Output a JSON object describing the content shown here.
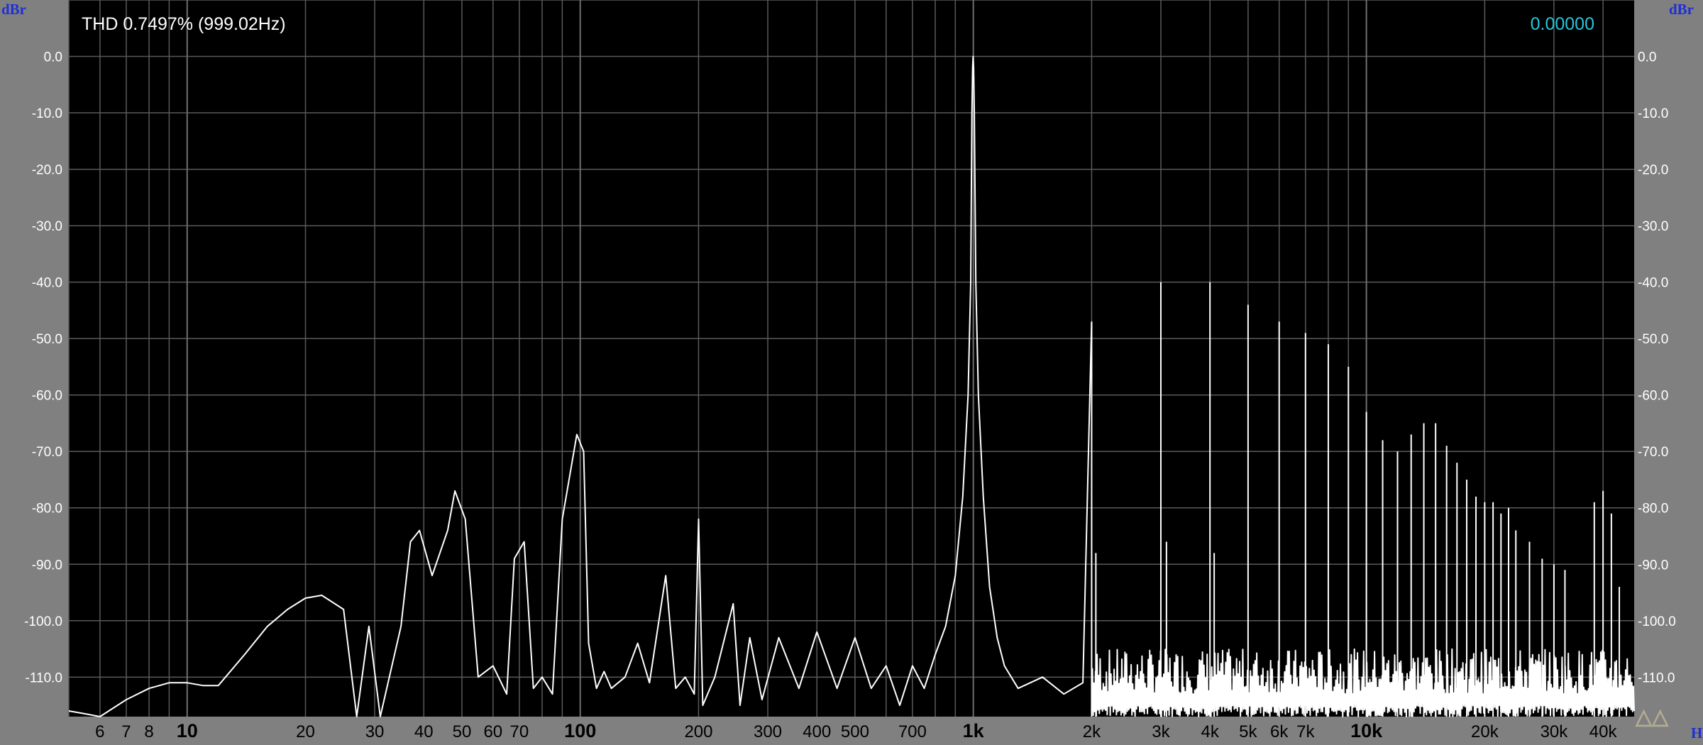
{
  "chart_data": {
    "type": "line",
    "title": "THD 0.7497% (999.02Hz)",
    "cursor_readout": "0.00000",
    "y_unit": "dBr",
    "x_unit": "Hz",
    "x_scale": "log",
    "xlim": [
      5,
      48000
    ],
    "ylim": [
      -117,
      10
    ],
    "grid": true,
    "y_ticks": [
      "0.0",
      "-10.0",
      "-20.0",
      "-30.0",
      "-40.0",
      "-50.0",
      "-60.0",
      "-70.0",
      "-80.0",
      "-90.0",
      "-100.0",
      "-110.0"
    ],
    "x_tick_labels": [
      {
        "value": 6,
        "label": "6",
        "major": false
      },
      {
        "value": 7,
        "label": "7",
        "major": false
      },
      {
        "value": 8,
        "label": "8",
        "major": false
      },
      {
        "value": 10,
        "label": "10",
        "major": true
      },
      {
        "value": 20,
        "label": "20",
        "major": false
      },
      {
        "value": 30,
        "label": "30",
        "major": false
      },
      {
        "value": 40,
        "label": "40",
        "major": false
      },
      {
        "value": 50,
        "label": "50",
        "major": false
      },
      {
        "value": 60,
        "label": "60",
        "major": false
      },
      {
        "value": 70,
        "label": "70",
        "major": false
      },
      {
        "value": 100,
        "label": "100",
        "major": true
      },
      {
        "value": 200,
        "label": "200",
        "major": false
      },
      {
        "value": 300,
        "label": "300",
        "major": false
      },
      {
        "value": 400,
        "label": "400",
        "major": false
      },
      {
        "value": 500,
        "label": "500",
        "major": false
      },
      {
        "value": 700,
        "label": "700",
        "major": false
      },
      {
        "value": 1000,
        "label": "1k",
        "major": true
      },
      {
        "value": 2000,
        "label": "2k",
        "major": false
      },
      {
        "value": 3000,
        "label": "3k",
        "major": false
      },
      {
        "value": 4000,
        "label": "4k",
        "major": false
      },
      {
        "value": 5000,
        "label": "5k",
        "major": false
      },
      {
        "value": 6000,
        "label": "6k",
        "major": false
      },
      {
        "value": 7000,
        "label": "7k",
        "major": false
      },
      {
        "value": 10000,
        "label": "10k",
        "major": true
      },
      {
        "value": 20000,
        "label": "20k",
        "major": false
      },
      {
        "value": 30000,
        "label": "30k",
        "major": false
      },
      {
        "value": 40000,
        "label": "40k",
        "major": false
      }
    ],
    "series": [
      {
        "points": [
          [
            5,
            -116
          ],
          [
            5.5,
            -116.5
          ],
          [
            6,
            -117
          ],
          [
            7,
            -114
          ],
          [
            8,
            -112
          ],
          [
            9,
            -111
          ],
          [
            10,
            -111
          ],
          [
            11,
            -111.5
          ],
          [
            12,
            -111.5
          ],
          [
            14,
            -106
          ],
          [
            16,
            -101
          ],
          [
            18,
            -98
          ],
          [
            20,
            -96
          ],
          [
            22,
            -95.5
          ],
          [
            25,
            -98
          ],
          [
            27,
            -117
          ],
          [
            29,
            -101
          ],
          [
            31,
            -117
          ],
          [
            35,
            -101
          ],
          [
            37,
            -86
          ],
          [
            39,
            -84
          ],
          [
            42,
            -92
          ],
          [
            46,
            -84
          ],
          [
            48,
            -77
          ],
          [
            51,
            -82
          ],
          [
            55,
            -110
          ],
          [
            60,
            -108
          ],
          [
            65,
            -113
          ],
          [
            68,
            -89
          ],
          [
            72,
            -86
          ],
          [
            76,
            -112
          ],
          [
            80,
            -110
          ],
          [
            85,
            -113
          ],
          [
            90,
            -82
          ],
          [
            98,
            -67
          ],
          [
            102,
            -70
          ],
          [
            105,
            -104
          ],
          [
            110,
            -112
          ],
          [
            115,
            -109
          ],
          [
            120,
            -112
          ],
          [
            130,
            -110
          ],
          [
            140,
            -104
          ],
          [
            150,
            -111
          ],
          [
            165,
            -92
          ],
          [
            175,
            -112
          ],
          [
            185,
            -110
          ],
          [
            195,
            -113
          ],
          [
            200,
            -82
          ],
          [
            205,
            -115
          ],
          [
            220,
            -110
          ],
          [
            245,
            -97
          ],
          [
            255,
            -115
          ],
          [
            270,
            -103
          ],
          [
            290,
            -114
          ],
          [
            320,
            -103
          ],
          [
            360,
            -112
          ],
          [
            400,
            -102
          ],
          [
            450,
            -112
          ],
          [
            500,
            -103
          ],
          [
            550,
            -112
          ],
          [
            600,
            -108
          ],
          [
            650,
            -115
          ],
          [
            700,
            -108
          ],
          [
            750,
            -112
          ],
          [
            800,
            -106
          ],
          [
            850,
            -101
          ],
          [
            900,
            -92
          ],
          [
            940,
            -78
          ],
          [
            970,
            -60
          ],
          [
            985,
            -40
          ],
          [
            992,
            -10
          ],
          [
            996,
            -2
          ],
          [
            999,
            0
          ],
          [
            1002,
            -2
          ],
          [
            1006,
            -10
          ],
          [
            1015,
            -40
          ],
          [
            1030,
            -60
          ],
          [
            1060,
            -78
          ],
          [
            1100,
            -94
          ],
          [
            1150,
            -103
          ],
          [
            1200,
            -108
          ],
          [
            1300,
            -112
          ],
          [
            1500,
            -110
          ],
          [
            1700,
            -113
          ],
          [
            1900,
            -111
          ],
          [
            2000,
            -47
          ]
        ]
      }
    ],
    "spikes": [
      [
        2000,
        -47
      ],
      [
        2050,
        -88
      ],
      [
        3000,
        -40
      ],
      [
        3100,
        -86
      ],
      [
        4000,
        -40
      ],
      [
        4100,
        -88
      ],
      [
        5000,
        -44
      ],
      [
        6000,
        -47
      ],
      [
        7000,
        -49
      ],
      [
        8000,
        -51
      ],
      [
        9000,
        -55
      ],
      [
        10000,
        -63
      ],
      [
        11000,
        -68
      ],
      [
        12000,
        -70
      ],
      [
        13000,
        -67
      ],
      [
        14000,
        -65
      ],
      [
        15000,
        -65
      ],
      [
        16000,
        -69
      ],
      [
        17000,
        -72
      ],
      [
        18000,
        -75
      ],
      [
        19000,
        -78
      ],
      [
        20000,
        -79
      ],
      [
        21000,
        -79
      ],
      [
        22000,
        -81
      ],
      [
        23000,
        -80
      ],
      [
        24000,
        -84
      ],
      [
        26000,
        -86
      ],
      [
        28000,
        -89
      ],
      [
        30000,
        -90
      ],
      [
        32000,
        -91
      ],
      [
        38000,
        -79
      ],
      [
        40000,
        -77
      ],
      [
        42000,
        -81
      ],
      [
        44000,
        -94
      ]
    ],
    "noise_floor": {
      "start_hz": 2000,
      "end_hz": 48000,
      "level_db": -112,
      "band_db": [
        -117,
        -105
      ]
    }
  }
}
